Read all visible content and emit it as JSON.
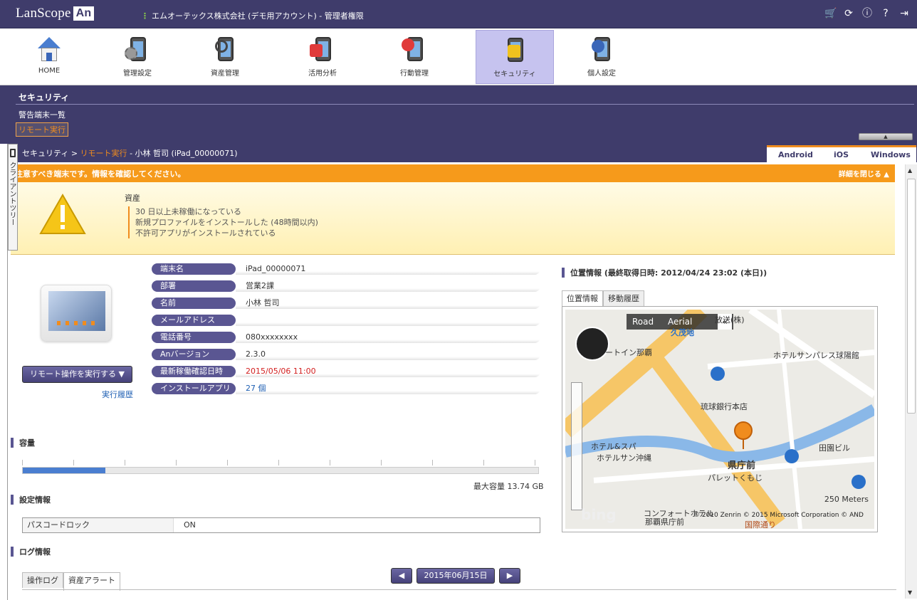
{
  "topbar": {
    "logo_text": "LanScope",
    "logo_badge": "An",
    "company": "エムオーテックス株式会社 (デモ用アカウント) - 管理者権限",
    "icons": [
      "cart-icon",
      "refresh-icon",
      "info-icon",
      "help-icon",
      "logout-icon"
    ]
  },
  "nav": [
    {
      "label": "HOME",
      "icon": "home-icon"
    },
    {
      "label": "管理設定",
      "icon": "settings-icon"
    },
    {
      "label": "資産管理",
      "icon": "asset-icon"
    },
    {
      "label": "活用分析",
      "icon": "analytics-icon"
    },
    {
      "label": "行動管理",
      "icon": "location-icon"
    },
    {
      "label": "セキュリティ",
      "icon": "lock-icon",
      "active": true
    },
    {
      "label": "個人設定",
      "icon": "user-icon"
    }
  ],
  "section": {
    "title": "セキュリティ",
    "link": "警告端末一覧",
    "active": "リモート実行"
  },
  "breadcrumb": {
    "root": "セキュリティ",
    "sep": ">",
    "current": "リモート実行",
    "detail": "- 小林 哲司 (iPad_00000071)"
  },
  "os_tabs": [
    "Android",
    "iOS",
    "Windows"
  ],
  "side_tree": "クライアントツリー",
  "alert": {
    "header": "注意すべき端末です。情報を確認してください。",
    "close": "詳細を閉じる ▲",
    "category": "資産",
    "items": [
      "30 日以上未稼働になっている",
      "新規プロファイルをインストールした (48時間以内)",
      "不許可アプリがインストールされている"
    ]
  },
  "device": {
    "remote_button": "リモート操作を実行する ▼",
    "history_link": "実行履歴",
    "rows": [
      {
        "label": "端末名",
        "value": "iPad_00000071"
      },
      {
        "label": "部署",
        "value": "営業2課"
      },
      {
        "label": "名前",
        "value": "小林 哲司"
      },
      {
        "label": "メールアドレス",
        "value": ""
      },
      {
        "label": "電話番号",
        "value": "080xxxxxxxx"
      },
      {
        "label": "Anバージョン",
        "value": "2.3.0"
      },
      {
        "label": "最新稼働確認日時",
        "value": "2015/05/06 11:00"
      },
      {
        "label": "インストールアプリ",
        "value": "27 個"
      }
    ]
  },
  "capacity": {
    "title": "容量",
    "used_fraction": 0.16,
    "max_label": "最大容量 13.74 GB"
  },
  "settings": {
    "title": "設定情報",
    "row_label": "パスコードロック",
    "row_value": "ON"
  },
  "log": {
    "title": "ログ情報",
    "tabs": [
      "操作ログ",
      "資産アラート"
    ],
    "prev": "◀",
    "date": "2015年06月15日",
    "next": "▶"
  },
  "location": {
    "title": "位置情報 (最終取得日時: 2012/04/24 23:02 (本日))",
    "tabs": [
      "位置情報",
      "移動履歴"
    ],
    "map": {
      "road": "Road",
      "aerial": "Aerial",
      "collapse": "«",
      "labels": [
        "久茂地",
        "ホテルサンパレス球陽館",
        "琉球銀行本店",
        "ホテル&スパ",
        "ホテルサン沖縄",
        "県庁前",
        "パレットくもじ",
        "田園ビル",
        "コンフォートホテル",
        "那覇県庁前",
        "国際通り",
        "放送(株)",
        "ートイン那覇"
      ],
      "scale": "250 Meters",
      "copyright": "© 2010 Zenrin  © 2015 Microsoft Corporation  © AND",
      "brand": "bing"
    }
  },
  "colors": {
    "primary": "#3f3c6b",
    "accent": "#f08c1e",
    "alert": "#f69a1b",
    "link": "#1e5fb3",
    "highlight": "#d32020"
  }
}
